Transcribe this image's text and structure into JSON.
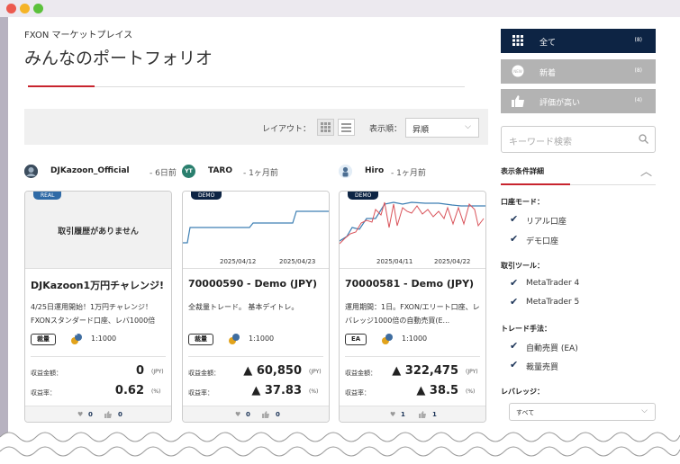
{
  "header": {
    "breadcrumb": "FXON マーケットプレイス",
    "title": "みんなのポートフォリオ"
  },
  "toolbar": {
    "layout_label": "レイアウト：",
    "sort_label": "表示順：",
    "sort_value": "昇順"
  },
  "cards": [
    {
      "author": "DJKazoon_Official",
      "time": "- 6日前",
      "account_tag": "REAL",
      "no_history": "取引履歴がありません",
      "name": "DJKazoon1万円チャレンジ!",
      "desc": "4/25日運用開始！1万円チャレンジ！FXONスタンダード口座、レバ1000倍",
      "badge": "裁量",
      "leverage": "1:1000",
      "profit_label": "収益金額：",
      "profit_value": "0",
      "profit_unit": "(JPY)",
      "rate_label": "収益率：",
      "rate_value": "0.62",
      "rate_unit": "(%)",
      "likes": "0",
      "thumbs": "0"
    },
    {
      "author": "TARO",
      "avatar_text": "YT",
      "time": "- 1ヶ月前",
      "account_tag": "DEMO",
      "date_start": "2025/04/12",
      "date_end": "2025/04/23",
      "name": "70000590 - Demo (JPY)",
      "desc": "全裁量トレード。 基本デイトレ。",
      "badge": "裁量",
      "leverage": "1:1000",
      "profit_label": "収益金額：",
      "profit_value": "▲ 60,850",
      "profit_unit": "(JPY)",
      "rate_label": "収益率：",
      "rate_value": "▲ 37.83",
      "rate_unit": "(%)",
      "likes": "0",
      "thumbs": "0"
    },
    {
      "author": "Hiro",
      "time": "- 1ヶ月前",
      "account_tag": "DEMO",
      "date_start": "2025/04/11",
      "date_end": "2025/04/22",
      "name": "70000581 - Demo (JPY)",
      "desc": "運用期間：1日。FXON/エリート口座、レバレッジ1000倍の自動売買(E...",
      "badge": "EA",
      "leverage": "1:1000",
      "profit_label": "収益金額：",
      "profit_value": "▲ 322,475",
      "profit_unit": "(JPY)",
      "rate_label": "収益率：",
      "rate_value": "▲ 38.5",
      "rate_unit": "(%)",
      "likes": "1",
      "thumbs": "1"
    }
  ],
  "sidebar": {
    "all": {
      "label": "全て",
      "count": "(8)"
    },
    "new": {
      "label": "新着",
      "count": "(8)"
    },
    "top_rated": {
      "label": "評価が高い",
      "count": "(4)"
    },
    "search_placeholder": "キーワード検索",
    "filter_title": "表示条件詳細",
    "groups": {
      "account_mode": {
        "label": "口座モード：",
        "options": [
          "リアル口座",
          "デモ口座"
        ]
      },
      "trade_tool": {
        "label": "取引ツール：",
        "options": [
          "MetaTrader 4",
          "MetaTrader 5"
        ]
      },
      "trade_method": {
        "label": "トレード手法：",
        "options": [
          "自動売買 (EA)",
          "裁量売買"
        ]
      },
      "leverage": {
        "label": "レバレッジ：",
        "value": "すべて"
      }
    }
  },
  "colors": {
    "navy": "#0d2444",
    "accent_red": "#c8242e",
    "gray_button": "#b3b3b3",
    "line_blue": "#3d7fb3",
    "line_red": "#d9535a"
  }
}
